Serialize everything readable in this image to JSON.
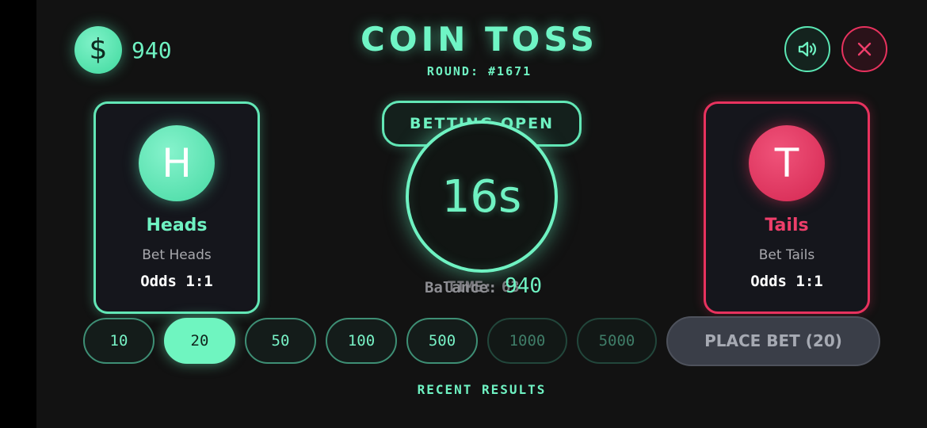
{
  "header": {
    "currency_symbol": "$",
    "balance": "940",
    "title": "COIN TOSS",
    "round": "ROUND: #1671"
  },
  "controls": {
    "sound_icon": "speaker-icon",
    "close_icon": "close-icon"
  },
  "sides": {
    "heads": {
      "letter": "H",
      "name": "Heads",
      "sub": "Bet Heads",
      "odds": "Odds 1:1",
      "color": "#62e7b6"
    },
    "tails": {
      "letter": "T",
      "name": "Tails",
      "sub": "Bet Tails",
      "odds": "Odds 1:1",
      "color": "#e8325e"
    }
  },
  "center": {
    "status": "BETTING OPEN",
    "timer": "16s",
    "time_ghost": "TIME: 63",
    "balance_label": "Balance:",
    "balance_value": "940"
  },
  "chips": [
    {
      "label": "10",
      "state": "normal"
    },
    {
      "label": "20",
      "state": "selected"
    },
    {
      "label": "50",
      "state": "normal"
    },
    {
      "label": "100",
      "state": "normal"
    },
    {
      "label": "500",
      "state": "normal"
    },
    {
      "label": "1000",
      "state": "disabled"
    },
    {
      "label": "5000",
      "state": "disabled"
    }
  ],
  "place_bet_label": "PLACE BET (20)",
  "recent_results_label": "RECENT RESULTS",
  "colors": {
    "accent": "#6ff2c2",
    "danger": "#e8325e",
    "background": "#121212"
  }
}
